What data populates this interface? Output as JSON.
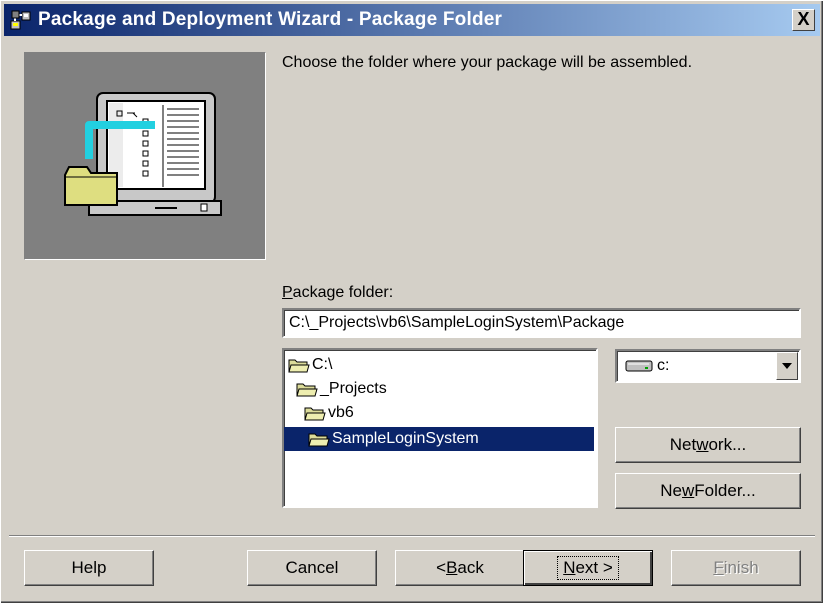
{
  "window": {
    "title": "Package and Deployment Wizard - Package Folder",
    "close_symbol": "X"
  },
  "icons": {
    "app": "package-wizard-icon",
    "picture": "computer-folder-illustration",
    "folder": "open-folder-icon",
    "drive": "hard-drive-icon",
    "dropdown": "triangle-down-icon"
  },
  "instruction": "Choose the folder where your package will be assembled.",
  "package_folder": {
    "label_mnemonic": "P",
    "label_rest": "ackage folder:",
    "value": "C:\\_Projects\\vb6\\SampleLoginSystem\\Package"
  },
  "folder_tree": {
    "items": [
      {
        "label": "C:\\",
        "selected": false
      },
      {
        "label": "_Projects",
        "selected": false
      },
      {
        "label": "vb6",
        "selected": false
      },
      {
        "label": "SampleLoginSystem",
        "selected": true
      }
    ]
  },
  "drive": {
    "selected": "c:"
  },
  "buttons": {
    "network_pre": "Net",
    "network_mnemonic": "w",
    "network_post": "ork...",
    "new_folder_pre": "Ne",
    "new_folder_mnemonic": "w",
    "new_folder_post": " Folder...",
    "help": "Help",
    "cancel": "Cancel",
    "back_pre": "< ",
    "back_mnemonic": "B",
    "back_post": "ack",
    "next_mnemonic": "N",
    "next_post": "ext >",
    "finish_mnemonic": "F",
    "finish_post": "inish"
  },
  "colors": {
    "title_gradient_start": "#0a246a",
    "title_gradient_end": "#a6caf0",
    "selection": "#0a246a",
    "face": "#d4d0c8"
  }
}
